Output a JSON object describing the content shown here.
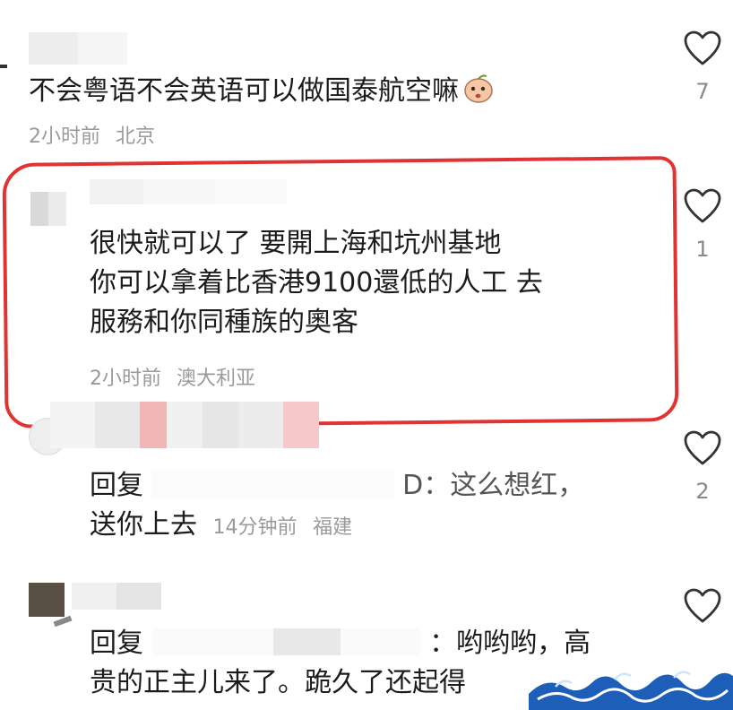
{
  "comments": [
    {
      "text": "不会粤语不会英语可以做国泰航空嘛",
      "time": "2小时前",
      "location": "北京",
      "likes": "7",
      "emoji_icon": "peach-face-emoji-icon"
    },
    {
      "lines": [
        "很快就可以了 要開上海和坑州基地",
        "你可以拿着比香港9100還低的人工 去",
        "服務和你同種族的奧客"
      ],
      "time": "2小时前",
      "location": "澳大利亚",
      "likes": "1"
    },
    {
      "reply_prefix": "回复",
      "reply_tail": "D：这么想红，",
      "line2": "送你上去",
      "time": "14分钟前",
      "location": "福建",
      "likes": "2"
    },
    {
      "reply_prefix": "回复",
      "reply_tail": "：哟哟哟，高",
      "line2": "贵的正主儿来了。跪久了还起得",
      "likes": ""
    }
  ],
  "colors": {
    "highlight": "#e23333",
    "text": "#1c1c1c",
    "meta": "#9a9a9a"
  }
}
